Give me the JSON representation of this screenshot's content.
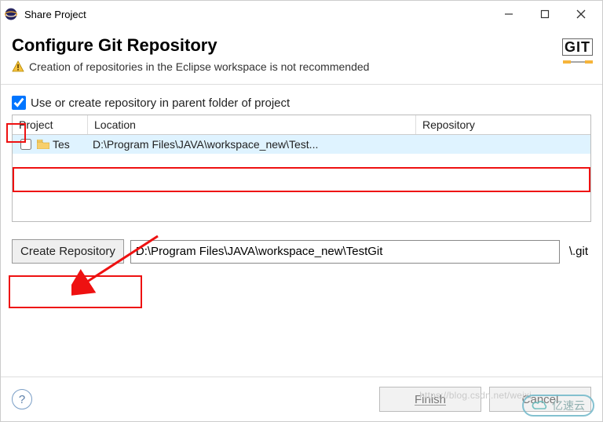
{
  "window": {
    "title": "Share Project"
  },
  "header": {
    "heading": "Configure Git Repository",
    "warning": "Creation of repositories in the Eclipse workspace is not recommended",
    "git_badge": "GIT"
  },
  "options": {
    "use_parent_label": "Use or create repository in parent folder of project",
    "use_parent_checked": true
  },
  "table": {
    "columns": {
      "project": "Project",
      "location": "Location",
      "repository": "Repository"
    },
    "rows": [
      {
        "checked": false,
        "project": "Tes",
        "location": "D:\\Program Files\\JAVA\\workspace_new\\Test...",
        "repository": ""
      }
    ]
  },
  "create": {
    "button": "Create Repository",
    "path": "D:\\Program Files\\JAVA\\workspace_new\\TestGit",
    "suffix": "\\.git"
  },
  "footer": {
    "finish": "Finish",
    "cancel": "Cancel"
  },
  "watermark": {
    "url": "https://blog.csdn.net/weixi",
    "brand": "亿速云"
  }
}
